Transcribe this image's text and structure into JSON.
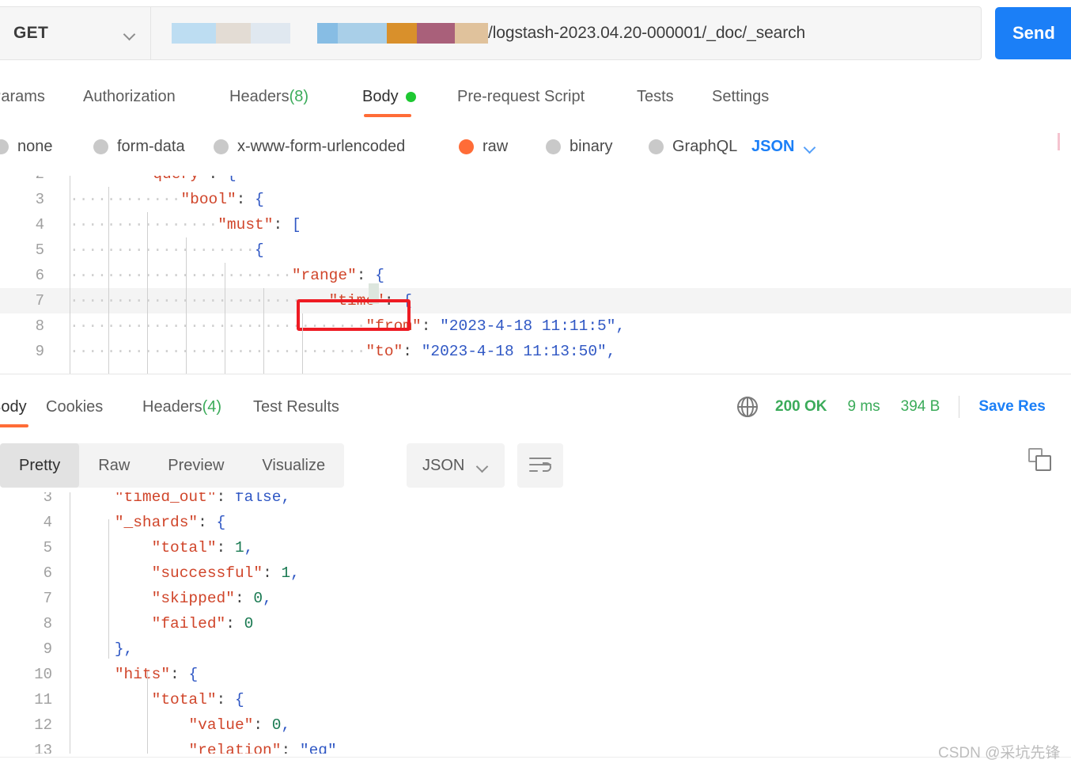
{
  "request": {
    "method": "GET",
    "url_path": "/logstash-2023.04.20-000001/_doc/_search",
    "url_redacted_blocks": [
      "#bdddf2",
      "#e3dcd4",
      "#e0e8f0",
      "#87bde4",
      "#a9cfe8",
      "#d9902b",
      "#a9607a",
      "#e0c29c"
    ],
    "send_label": "Send",
    "method_chevron": "chevron-down-icon"
  },
  "request_tabs": [
    {
      "label": "Params",
      "active": false
    },
    {
      "label": "Authorization",
      "active": false
    },
    {
      "label": "Headers (8)",
      "active": false,
      "count": "(8)"
    },
    {
      "label": "Body",
      "active": true,
      "dot": "#1ec832"
    },
    {
      "label": "Pre-request Script",
      "active": false
    },
    {
      "label": "Tests",
      "active": false
    },
    {
      "label": "Settings",
      "active": false
    }
  ],
  "body_types": [
    {
      "label": "none",
      "selected": false
    },
    {
      "label": "form-data",
      "selected": false
    },
    {
      "label": "x-www-form-urlencoded",
      "selected": false
    },
    {
      "label": "raw",
      "selected": true
    },
    {
      "label": "binary",
      "selected": false
    },
    {
      "label": "GraphQL",
      "selected": false
    }
  ],
  "body_format": {
    "label": "JSON",
    "chevron": "chevron-down-icon",
    "color": "#1b7ff7"
  },
  "request_body_lines": [
    {
      "num": "2",
      "text": "        \"query\": {",
      "indent_dots": 8,
      "clipped_top": true
    },
    {
      "num": "3",
      "text": "            \"bool\": {",
      "indent_dots": 12
    },
    {
      "num": "4",
      "text": "                \"must\": [",
      "indent_dots": 16
    },
    {
      "num": "5",
      "text": "                    {",
      "indent_dots": 20
    },
    {
      "num": "6",
      "text": "                        \"range\": {",
      "indent_dots": 24
    },
    {
      "num": "7",
      "text": "                            \"time\": {",
      "indent_dots": 28,
      "highlighted": true
    },
    {
      "num": "8",
      "text": "                                \"from\": \"2023-4-18 11:11:5\",",
      "indent_dots": 32
    },
    {
      "num": "9",
      "text": "                                \"to\": \"2023-4-18 11:13:50\",",
      "indent_dots": 32
    }
  ],
  "annotation": {
    "type": "red-rectangle",
    "color": "#ee1b23",
    "targets_line": "7",
    "targets_text": "\"time\":"
  },
  "response_tabs": [
    {
      "label": "Body",
      "active": true
    },
    {
      "label": "Cookies",
      "active": false
    },
    {
      "label": "Headers (4)",
      "active": false,
      "count": "(4)"
    },
    {
      "label": "Test Results",
      "active": false
    }
  ],
  "response_meta": {
    "globe_icon": "globe-icon",
    "status": "200 OK",
    "time": "9 ms",
    "size": "394 B",
    "save_label": "Save Res",
    "status_color": "#3bab5a",
    "save_color": "#1b7ff7"
  },
  "response_toolbar": {
    "views": [
      {
        "label": "Pretty",
        "active": true
      },
      {
        "label": "Raw",
        "active": false
      },
      {
        "label": "Preview",
        "active": false
      },
      {
        "label": "Visualize",
        "active": false
      }
    ],
    "format": {
      "label": "JSON",
      "chevron": "chevron-down-icon"
    },
    "wrap_icon": "word-wrap-icon",
    "copy_icon": "copy-icon"
  },
  "response_body_lines": [
    {
      "num": "3",
      "text": "    \"timed_out\": false,",
      "clipped_top": true
    },
    {
      "num": "4",
      "text": "    \"_shards\": {"
    },
    {
      "num": "5",
      "text": "        \"total\": 1,"
    },
    {
      "num": "6",
      "text": "        \"successful\": 1,"
    },
    {
      "num": "7",
      "text": "        \"skipped\": 0,"
    },
    {
      "num": "8",
      "text": "        \"failed\": 0"
    },
    {
      "num": "9",
      "text": "    },"
    },
    {
      "num": "10",
      "text": "    \"hits\": {"
    },
    {
      "num": "11",
      "text": "        \"total\": {"
    },
    {
      "num": "12",
      "text": "            \"value\": 0,"
    },
    {
      "num": "13",
      "text": "            \"relation\": \"eq\"",
      "clipped_bottom": true
    }
  ],
  "watermark": "CSDN @采坑先锋"
}
